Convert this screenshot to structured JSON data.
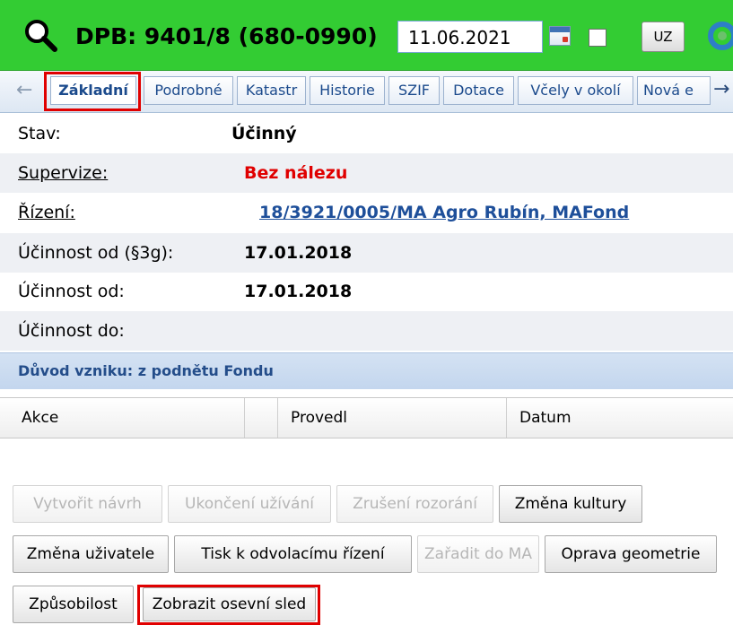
{
  "header": {
    "title": "DPB: 9401/8 (680-0990)",
    "date_value": "11.06.2021",
    "uz_label": "UZ",
    "accent_color": "#33cc33"
  },
  "tabs": [
    {
      "label": "Základní",
      "active": true
    },
    {
      "label": "Podrobné"
    },
    {
      "label": "Katastr"
    },
    {
      "label": "Historie"
    },
    {
      "label": "SZIF"
    },
    {
      "label": "Dotace"
    },
    {
      "label": "Včely v okolí"
    },
    {
      "label": "Nová e"
    }
  ],
  "properties": [
    {
      "label": "Stav:",
      "value": "Účinný"
    },
    {
      "label": "Supervize:",
      "value": "Bez nálezu"
    },
    {
      "label": "Řízení:",
      "value": "18/3921/0005/MA Agro Rubín, MAFond"
    },
    {
      "label": "Účinnost od (§3g):",
      "value": "17.01.2018"
    },
    {
      "label": "Účinnost od:",
      "value": "17.01.2018"
    },
    {
      "label": "Účinnost do:",
      "value": ""
    }
  ],
  "section": {
    "title": "Důvod vzniku: z podnětu Fondu",
    "columns": [
      "Akce",
      "",
      "Provedl",
      "Datum"
    ]
  },
  "buttons": {
    "row1": [
      {
        "label": "Vytvořit návrh",
        "enabled": false
      },
      {
        "label": "Ukončení užívání",
        "enabled": false
      },
      {
        "label": "Zrušení rozorání",
        "enabled": false
      },
      {
        "label": "Změna kultury",
        "enabled": true
      }
    ],
    "row2": [
      {
        "label": "Změna uživatele",
        "enabled": true
      },
      {
        "label": "Tisk k odvolacímu řízení",
        "enabled": true
      },
      {
        "label": "Zařadit do MA",
        "enabled": false
      },
      {
        "label": "Oprava geometrie",
        "enabled": true
      }
    ],
    "row3": [
      {
        "label": "Způsobilost",
        "enabled": true
      },
      {
        "label": "Zobrazit osevní sled",
        "enabled": true
      }
    ]
  }
}
